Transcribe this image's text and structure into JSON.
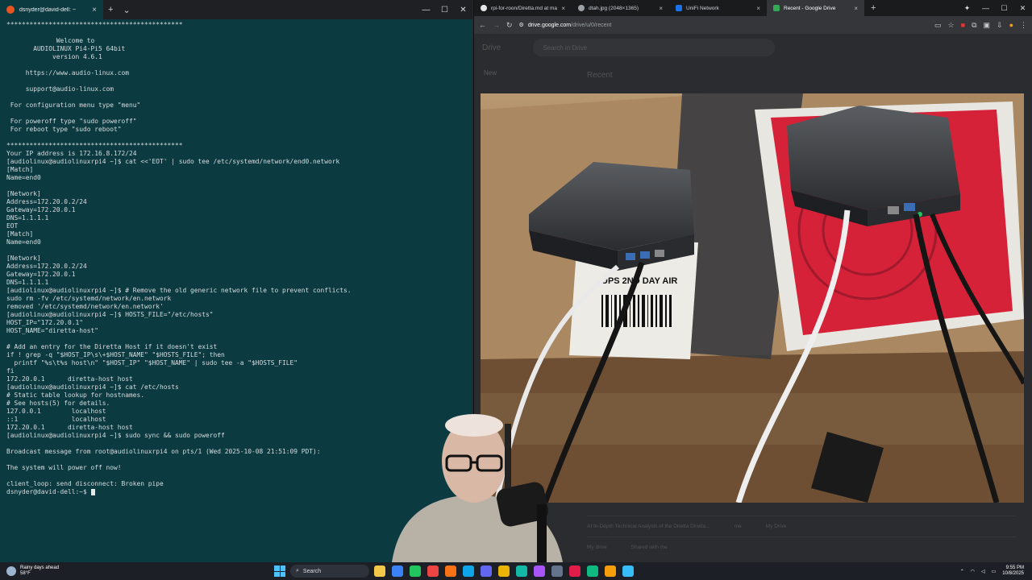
{
  "terminal": {
    "tab_title": "dsnyder@david-dell: ~",
    "new_tab": "+",
    "dropdown": "⌄",
    "lines": [
      "**********************************************",
      "",
      "             Welcome to",
      "       AUDIOLINUX Pi4-Pi5 64bit",
      "            version 4.6.1",
      "",
      "     https://www.audio-linux.com",
      "",
      "     support@audio-linux.com",
      "",
      " For configuration menu type \"menu\"",
      "",
      " For poweroff type \"sudo poweroff\"",
      " For reboot type \"sudo reboot\"",
      "",
      "**********************************************",
      "Your IP address is 172.16.8.172/24",
      "[audiolinux@audiolinuxrpi4 ~]$ cat <<'EOT' | sudo tee /etc/systemd/network/end0.network",
      "[Match]",
      "Name=end0",
      "",
      "[Network]",
      "Address=172.20.0.2/24",
      "Gateway=172.20.0.1",
      "DNS=1.1.1.1",
      "EOT",
      "[Match]",
      "Name=end0",
      "",
      "[Network]",
      "Address=172.20.0.2/24",
      "Gateway=172.20.0.1",
      "DNS=1.1.1.1",
      "[audiolinux@audiolinuxrpi4 ~]$ # Remove the old generic network file to prevent conflicts.",
      "sudo rm -fv /etc/systemd/network/en.network",
      "removed '/etc/systemd/network/en.network'",
      "[audiolinux@audiolinuxrpi4 ~]$ HOSTS_FILE=\"/etc/hosts\"",
      "HOST_IP=\"172.20.0.1\"",
      "HOST_NAME=\"diretta-host\"",
      "",
      "# Add an entry for the Diretta Host if it doesn't exist",
      "if ! grep -q \"$HOST_IP\\s\\+$HOST_NAME\" \"$HOSTS_FILE\"; then",
      "  printf \"%s\\t%s host\\n\" \"$HOST_IP\" \"$HOST_NAME\" | sudo tee -a \"$HOSTS_FILE\"",
      "fi",
      "172.20.0.1      diretta-host host",
      "[audiolinux@audiolinuxrpi4 ~]$ cat /etc/hosts",
      "# Static table lookup for hostnames.",
      "# See hosts(5) for details.",
      "127.0.0.1        localhost",
      "::1              localhost",
      "172.20.0.1      diretta-host host",
      "[audiolinux@audiolinuxrpi4 ~]$ sudo sync && sudo poweroff",
      "",
      "Broadcast message from root@audiolinuxrpi4 on pts/1 (Wed 2025-10-08 21:51:09 PDT):",
      "",
      "The system will power off now!",
      "",
      "client_loop: send disconnect: Broken pipe"
    ],
    "prompt": "dsnyder@david-dell:~$ "
  },
  "browser": {
    "tabs": [
      {
        "title": "rpi-for-roon/Diretta.md at mai",
        "icon_color": "#e6e6e6"
      },
      {
        "title": "dtah.jpg (2048×1365)",
        "icon_color": "#9aa0a6"
      },
      {
        "title": "UniFi Network",
        "icon_color": "#1a73e8"
      },
      {
        "title": "Recent - Google Drive",
        "icon_color": "#34a853"
      }
    ],
    "url_host": "drive.google.com",
    "url_path": "/drive/u/0/recent",
    "drive": {
      "logo": "Drive",
      "search_placeholder": "Search in Drive",
      "new_button": "New",
      "recent_title": "Recent",
      "rows": [
        {
          "name": "AI In-Depth Technical Analysis of the Diretta Diretta...",
          "who": "me",
          "loc": "My Drive"
        },
        {
          "name": "My drive",
          "who": "",
          "loc": "Shared with me"
        }
      ]
    },
    "photo_label": "UPS 2ND DAY AIR"
  },
  "taskbar": {
    "weather_line1": "Rainy days ahead",
    "weather_line2": "58°F",
    "search_label": "Search",
    "time": "9:55 PM",
    "date": "10/8/2025",
    "apps": [
      "#f3c84b",
      "#3b82f6",
      "#22c55e",
      "#ef4444",
      "#f97316",
      "#0ea5e9",
      "#6366f1",
      "#eab308",
      "#14b8a6",
      "#a855f7",
      "#64748b",
      "#e11d48",
      "#10b981",
      "#f59e0b",
      "#38bdf8"
    ]
  }
}
